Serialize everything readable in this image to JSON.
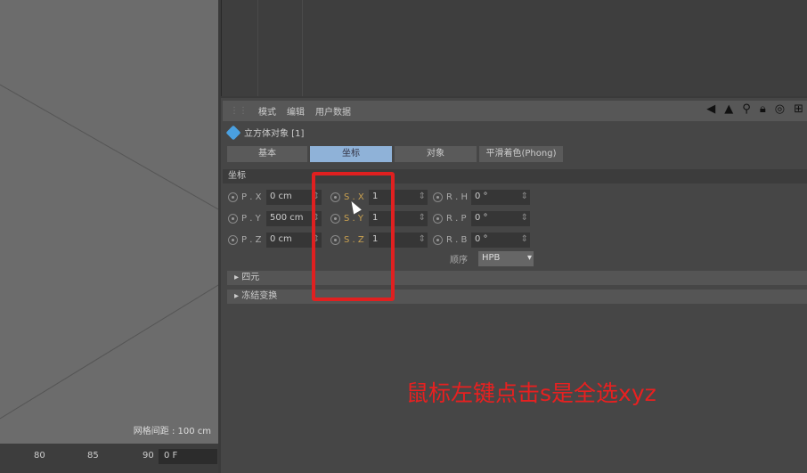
{
  "viewport": {
    "grid_label": "网格间距 : 100 cm"
  },
  "timeline": {
    "ticks": [
      "80",
      "85",
      "90"
    ],
    "frame": "0 F"
  },
  "attr": {
    "menu": [
      "模式",
      "编辑",
      "用户数据"
    ],
    "object_title": "立方体对象 [1]",
    "tabs": [
      "基本",
      "坐标",
      "对象",
      "平滑着色(Phong)"
    ],
    "active_tab": "坐标",
    "section": "坐标",
    "position": [
      {
        "label": "P . X",
        "value": "0 cm"
      },
      {
        "label": "P . Y",
        "value": "500 cm"
      },
      {
        "label": "P . Z",
        "value": "0 cm"
      }
    ],
    "scale": [
      {
        "label": "S . X",
        "value": "1"
      },
      {
        "label": "S . Y",
        "value": "1"
      },
      {
        "label": "S . Z",
        "value": "1"
      }
    ],
    "rotation": [
      {
        "label": "R . H",
        "value": "0 °"
      },
      {
        "label": "R . P",
        "value": "0 °"
      },
      {
        "label": "R . B",
        "value": "0 °"
      }
    ],
    "order_label": "顺序",
    "order_value": "HPB",
    "collapsibles": [
      "四元",
      "冻结变换"
    ]
  },
  "annotation": "鼠标左键点击s是全选xyz"
}
